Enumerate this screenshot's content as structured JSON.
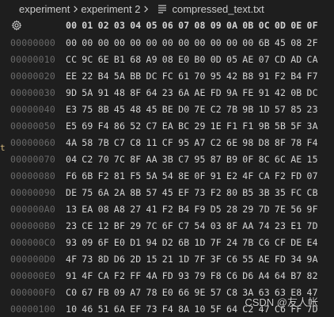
{
  "breadcrumb": {
    "folder": "experiment",
    "subfolder": "experiment 2",
    "file": "compressed_text.txt",
    "separator": "›"
  },
  "hex": {
    "columns": [
      "00",
      "01",
      "02",
      "03",
      "04",
      "05",
      "06",
      "07",
      "08",
      "09",
      "0A",
      "0B",
      "0C",
      "0D",
      "0E",
      "0F"
    ],
    "rows": [
      {
        "offset": "00000000",
        "bytes": [
          "00",
          "00",
          "00",
          "00",
          "00",
          "00",
          "00",
          "00",
          "00",
          "00",
          "00",
          "00",
          "6B",
          "45",
          "08",
          "2F"
        ]
      },
      {
        "offset": "00000010",
        "bytes": [
          "CC",
          "9C",
          "6E",
          "B1",
          "68",
          "A9",
          "08",
          "E0",
          "B0",
          "0D",
          "05",
          "AE",
          "07",
          "CD",
          "AD",
          "CA"
        ]
      },
      {
        "offset": "00000020",
        "bytes": [
          "EE",
          "22",
          "B4",
          "5A",
          "BB",
          "DC",
          "FC",
          "61",
          "70",
          "95",
          "42",
          "B8",
          "91",
          "F2",
          "B4",
          "F7"
        ]
      },
      {
        "offset": "00000030",
        "bytes": [
          "9D",
          "5A",
          "91",
          "48",
          "8F",
          "64",
          "23",
          "6A",
          "AE",
          "FD",
          "9A",
          "FE",
          "91",
          "42",
          "0B",
          "DC"
        ]
      },
      {
        "offset": "00000040",
        "bytes": [
          "E3",
          "75",
          "8B",
          "45",
          "48",
          "45",
          "BE",
          "D0",
          "7E",
          "C2",
          "7B",
          "9B",
          "1D",
          "57",
          "85",
          "23"
        ]
      },
      {
        "offset": "00000050",
        "bytes": [
          "E5",
          "69",
          "F4",
          "86",
          "52",
          "C7",
          "EA",
          "BC",
          "29",
          "1E",
          "F1",
          "F1",
          "9B",
          "5B",
          "5F",
          "3A"
        ]
      },
      {
        "offset": "00000060",
        "bytes": [
          "4A",
          "58",
          "7B",
          "C7",
          "C8",
          "11",
          "CF",
          "95",
          "A7",
          "C2",
          "6E",
          "98",
          "D8",
          "8F",
          "78",
          "F4"
        ]
      },
      {
        "offset": "00000070",
        "bytes": [
          "04",
          "C2",
          "70",
          "7C",
          "8F",
          "AA",
          "3B",
          "C7",
          "95",
          "87",
          "B9",
          "0F",
          "8C",
          "6C",
          "AE",
          "15"
        ]
      },
      {
        "offset": "00000080",
        "bytes": [
          "F6",
          "6B",
          "F2",
          "81",
          "F5",
          "5A",
          "54",
          "8E",
          "0F",
          "91",
          "E2",
          "4F",
          "CA",
          "F2",
          "FD",
          "07"
        ]
      },
      {
        "offset": "00000090",
        "bytes": [
          "DE",
          "75",
          "6A",
          "2A",
          "8B",
          "57",
          "45",
          "EF",
          "73",
          "F2",
          "80",
          "B5",
          "3B",
          "35",
          "FC",
          "CB"
        ]
      },
      {
        "offset": "000000A0",
        "bytes": [
          "13",
          "EA",
          "08",
          "A8",
          "27",
          "41",
          "F2",
          "B4",
          "F9",
          "D5",
          "28",
          "29",
          "7D",
          "7E",
          "56",
          "9F"
        ]
      },
      {
        "offset": "000000B0",
        "bytes": [
          "23",
          "CE",
          "12",
          "BF",
          "29",
          "7C",
          "6F",
          "C7",
          "54",
          "03",
          "8F",
          "AA",
          "74",
          "23",
          "E1",
          "7D"
        ]
      },
      {
        "offset": "000000C0",
        "bytes": [
          "93",
          "09",
          "6F",
          "E0",
          "D1",
          "94",
          "D2",
          "6B",
          "1D",
          "7F",
          "24",
          "7B",
          "C6",
          "CF",
          "DE",
          "E4"
        ]
      },
      {
        "offset": "000000D0",
        "bytes": [
          "4F",
          "73",
          "8D",
          "D6",
          "2D",
          "15",
          "21",
          "1D",
          "7F",
          "3F",
          "C6",
          "55",
          "AE",
          "FD",
          "34",
          "9A"
        ]
      },
      {
        "offset": "000000E0",
        "bytes": [
          "91",
          "4F",
          "CA",
          "F2",
          "FF",
          "4A",
          "FD",
          "93",
          "79",
          "F8",
          "C6",
          "D6",
          "A4",
          "64",
          "B7",
          "82"
        ]
      },
      {
        "offset": "000000F0",
        "bytes": [
          "C0",
          "67",
          "FB",
          "09",
          "A7",
          "78",
          "E0",
          "66",
          "9E",
          "57",
          "C8",
          "3A",
          "63",
          "63",
          "E8",
          "47"
        ]
      },
      {
        "offset": "00000100",
        "bytes": [
          "10",
          "46",
          "51",
          "6A",
          "EF",
          "73",
          "F4",
          "8A",
          "10",
          "5F",
          "64",
          "C2",
          "47",
          "C6",
          "FF",
          "7D"
        ]
      }
    ]
  },
  "icons": {
    "gear": "gear-icon",
    "file": "file-lines-icon",
    "separator": "chevron-right-icon"
  },
  "colors": {
    "background": "#1e1e1e",
    "text": "#d4d4d4",
    "offset": "#6a6a6a",
    "header": "#cccccc"
  },
  "watermark": "CSDN @友人帐"
}
